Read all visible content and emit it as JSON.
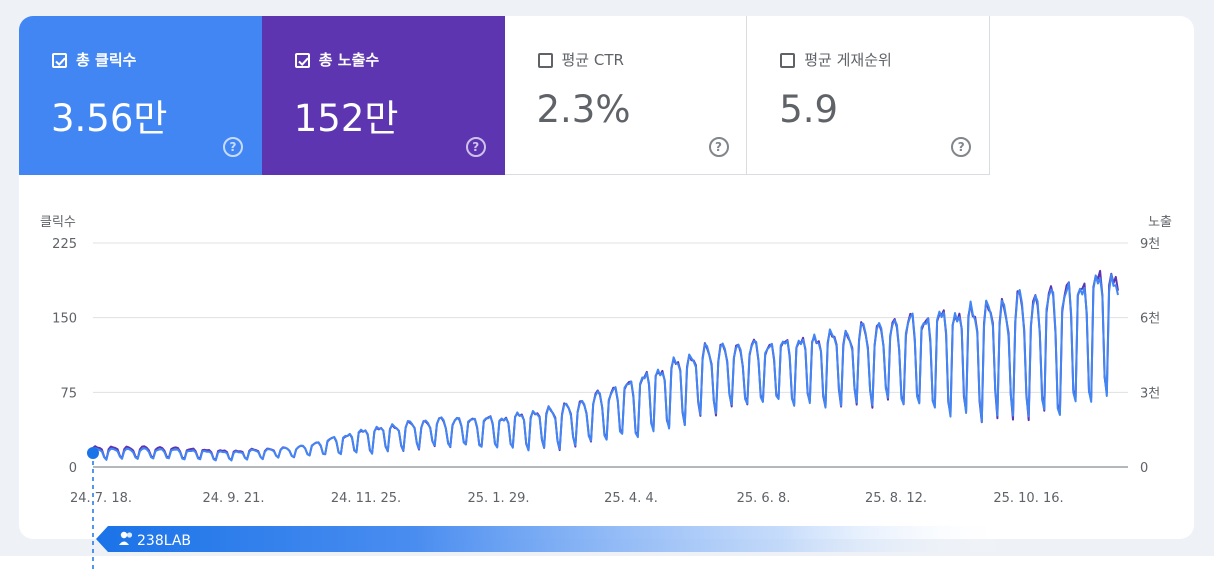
{
  "metrics": [
    {
      "id": "clicks",
      "label": "총 클릭수",
      "value": "3.56만",
      "checked": true,
      "help": "?"
    },
    {
      "id": "impressions",
      "label": "총 노출수",
      "value": "152만",
      "checked": true,
      "help": "?"
    },
    {
      "id": "ctr",
      "label": "평균 CTR",
      "value": "2.3%",
      "checked": false,
      "help": "?"
    },
    {
      "id": "position",
      "label": "평균 게재순위",
      "value": "5.9",
      "checked": false,
      "help": "?"
    }
  ],
  "colors": {
    "clicks": "#4286f4",
    "impressions": "#5e35b1",
    "grid": "#e0e0e0",
    "marker": "#1a73e8"
  },
  "chart_data": {
    "type": "line",
    "left_axis_label": "클릭수",
    "right_axis_label": "노출",
    "left_ticks": [
      "225",
      "150",
      "75",
      "0"
    ],
    "right_ticks": [
      "9천",
      "6천",
      "3천",
      "0"
    ],
    "ylim_left": [
      0,
      225
    ],
    "ylim_right": [
      0,
      9000
    ],
    "x_tick_labels": [
      "24. 7. 18.",
      "24. 9. 21.",
      "24. 11. 25.",
      "25. 1. 29.",
      "25. 4. 4.",
      "25. 6. 8.",
      "25. 8. 12.",
      "25. 10. 16."
    ],
    "series": [
      {
        "name": "총 클릭수",
        "axis": "left",
        "weekday_level": [
          18,
          18,
          15,
          20,
          38,
          48,
          50,
          62,
          90,
          120,
          125,
          135,
          150,
          160,
          175,
          195
        ],
        "weekend_level": [
          8,
          8,
          7,
          10,
          15,
          20,
          20,
          20,
          32,
          55,
          65,
          65,
          60,
          55,
          45,
          85
        ]
      },
      {
        "name": "총 노출수",
        "axis": "right",
        "weekday_level": [
          800,
          800,
          650,
          800,
          1500,
          1900,
          2000,
          2500,
          3600,
          4800,
          5000,
          5400,
          6000,
          6400,
          7000,
          8000
        ],
        "weekend_level": [
          350,
          350,
          300,
          400,
          600,
          800,
          800,
          800,
          1300,
          2200,
          2600,
          2600,
          2400,
          2200,
          1800,
          3400
        ]
      }
    ]
  },
  "watermark": {
    "text": "238LAB"
  }
}
